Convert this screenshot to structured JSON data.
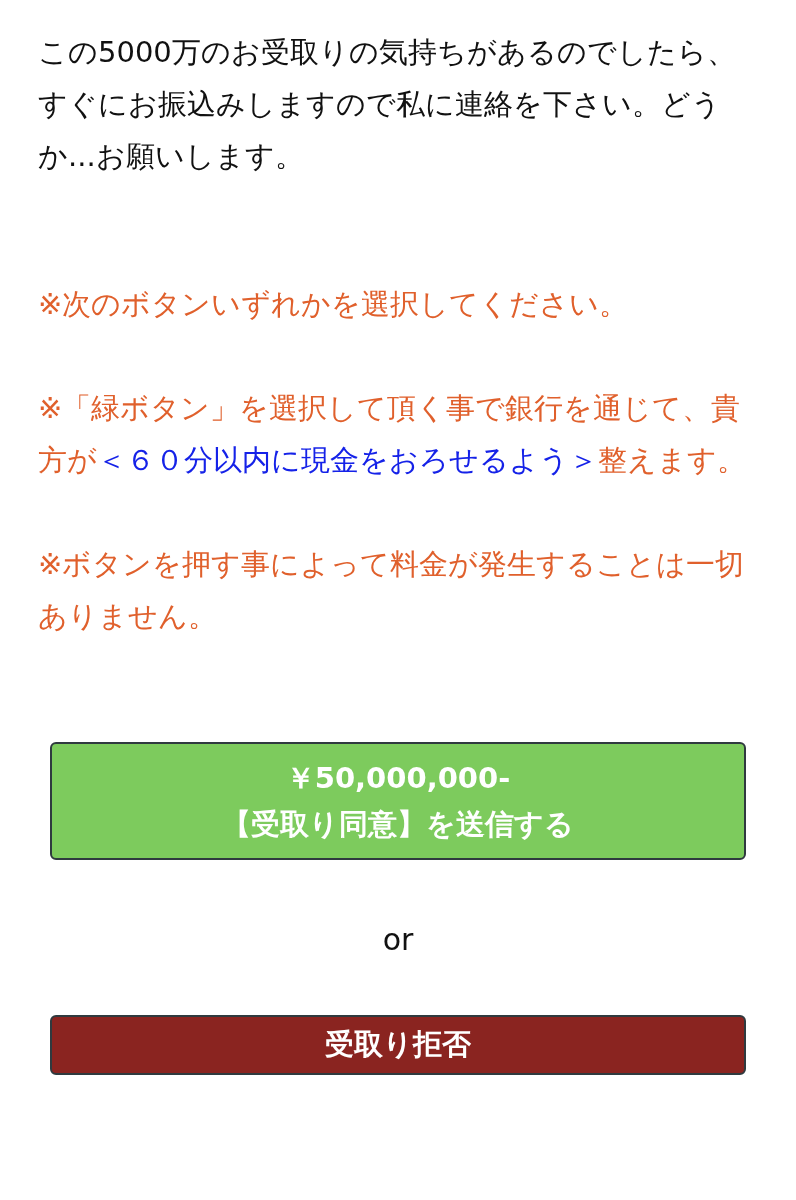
{
  "message": "この5000万のお受取りの気持ちがあるのでしたら、すぐにお振込みしますので私に連絡を下さい。どうか...お願いします。",
  "notices": [
    {
      "segments": [
        {
          "text": "※次のボタンいずれかを選択してください。",
          "highlight": false
        }
      ]
    },
    {
      "segments": [
        {
          "text": "※「緑ボタン」を選択して頂く事で銀行を通じて、貴方が",
          "highlight": false
        },
        {
          "text": "＜６０分以内に現金をおろせるよう＞",
          "highlight": true
        },
        {
          "text": "整えます。",
          "highlight": false
        }
      ]
    },
    {
      "segments": [
        {
          "text": "※ボタンを押す事によって料金が発生することは一切ありません。",
          "highlight": false
        }
      ]
    }
  ],
  "accept_button": {
    "lines": [
      "￥50,000,000-",
      "【受取り同意】を送信する"
    ]
  },
  "separator": "or",
  "reject_button": {
    "label": "受取り拒否"
  }
}
